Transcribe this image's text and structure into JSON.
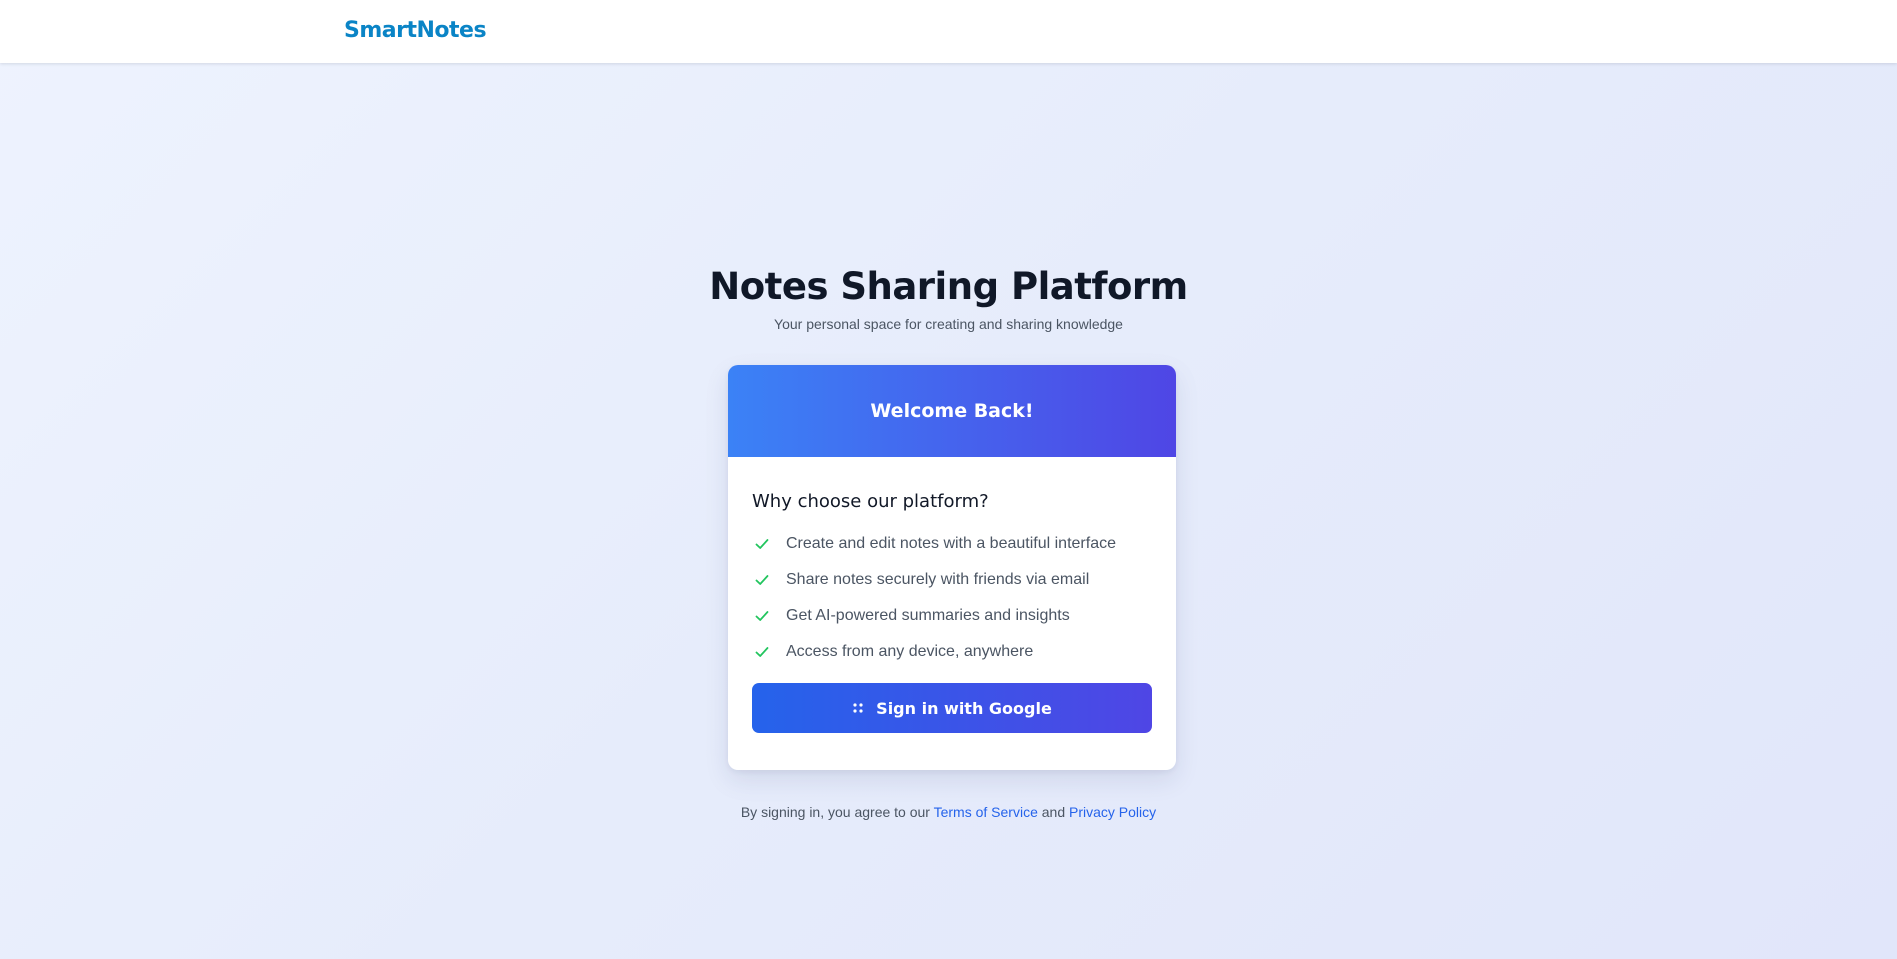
{
  "navbar": {
    "brand": "SmartNotes"
  },
  "hero": {
    "title": "Notes Sharing Platform",
    "subtitle": "Your personal space for creating and sharing knowledge"
  },
  "card": {
    "header_title": "Welcome Back!",
    "section_title": "Why choose our platform?",
    "features": [
      "Create and edit notes with a beautiful interface",
      "Share notes securely with friends via email",
      "Get AI-powered summaries and insights",
      "Access from any device, anywhere"
    ],
    "feature_icon": "check-icon",
    "signin_button": {
      "label": "Sign in with Google",
      "icon": "google-icon"
    }
  },
  "legal": {
    "prefix": "By signing in, you agree to our",
    "terms_link": "Terms of Service",
    "conjunction": "and",
    "privacy_link": "Privacy Policy"
  },
  "colors": {
    "brand": "#0a84c6",
    "header_gradient_start": "#3b82f6",
    "header_gradient_end": "#4f46e5",
    "button_gradient_start": "#2563eb",
    "button_gradient_end": "#4f46e5",
    "check": "#22c55e",
    "link": "#2563eb"
  }
}
